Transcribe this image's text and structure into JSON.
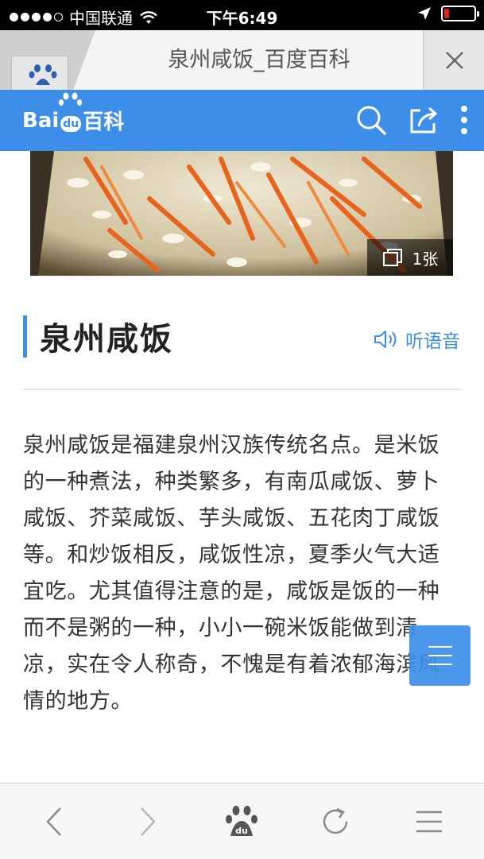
{
  "status": {
    "carrier": "中国联通",
    "time": "下午6:49"
  },
  "tab": {
    "title": "泉州咸饭_百度百科"
  },
  "header": {
    "logo_text": "Bai",
    "logo_du": "du",
    "logo_suffix": "百科"
  },
  "hero": {
    "image_count": "1张"
  },
  "article": {
    "title": "泉州咸饭",
    "listen_label": "听语音",
    "body": "泉州咸饭是福建泉州汉族传统名点。是米饭的一种煮法，种类繁多，有南瓜咸饭、萝卜咸饭、芥菜咸饭、芋头咸饭、五花肉丁咸饭等。和炒饭相反，咸饭性凉，夏季火气大适宜吃。尤其值得注意的是，咸饭是饭的一种而不是粥的一种，小小一碗米饭能做到清凉，实在令人称奇，不愧是有着浓郁海滨风情的地方。"
  },
  "toolbar": {
    "items": [
      "back-icon",
      "forward-icon",
      "baidu-paw-icon",
      "refresh-icon",
      "menu-icon"
    ]
  },
  "colors": {
    "accent": "#3c8ee9",
    "battery_low": "#e0231c"
  }
}
